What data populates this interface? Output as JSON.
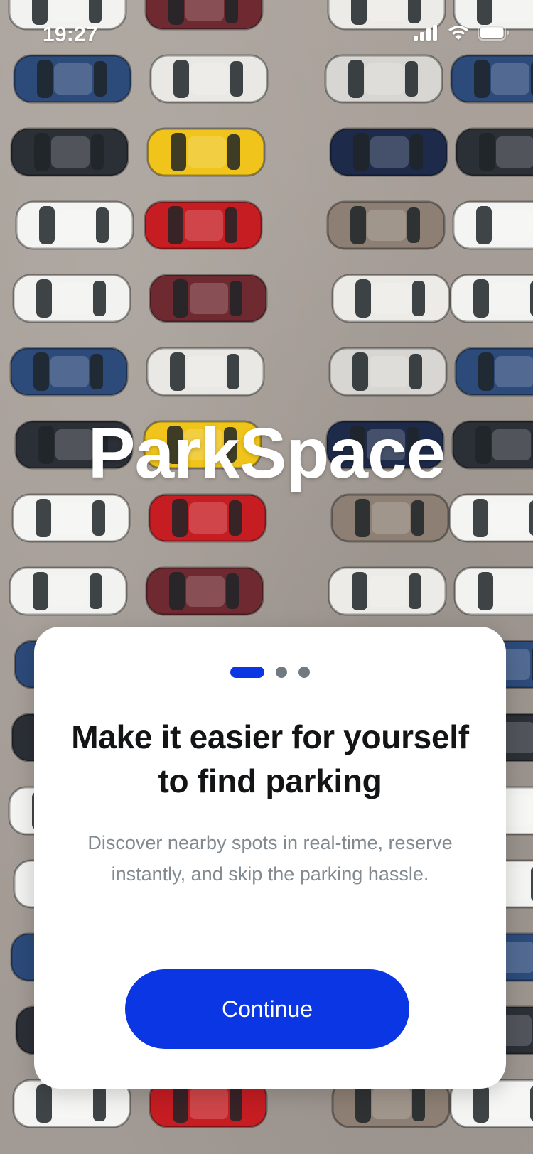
{
  "status_bar": {
    "time": "19:27",
    "icons": [
      "signal-icon",
      "wifi-icon",
      "battery-icon"
    ]
  },
  "app": {
    "title": "ParkSpace"
  },
  "onboarding": {
    "pager": {
      "total": 3,
      "active_index": 0
    },
    "heading": "Make it easier for yourself to find parking",
    "subtext": "Discover nearby spots in real-time, reserve instantly, and skip the parking hassle.",
    "continue_label": "Continue"
  },
  "colors": {
    "accent": "#0a36e3",
    "heading": "#121416",
    "subtext": "#828a90",
    "inactive_dot": "#717a80",
    "card": "#ffffff"
  }
}
